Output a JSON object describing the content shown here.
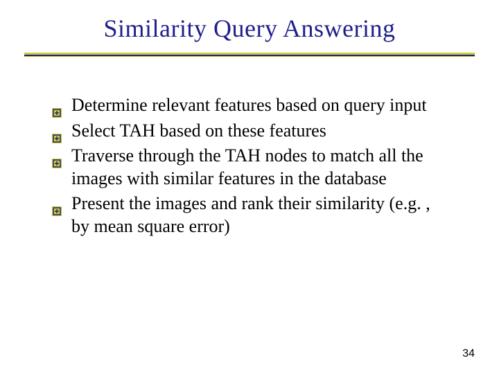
{
  "title": "Similarity Query Answering",
  "bullets": [
    "Determine relevant features based on query input",
    "Select TAH based on these features",
    "Traverse through the TAH nodes to match all the images with similar features in the database",
    "Present the images and rank their similarity (e.g. , by mean square error)"
  ],
  "page_number": "34"
}
